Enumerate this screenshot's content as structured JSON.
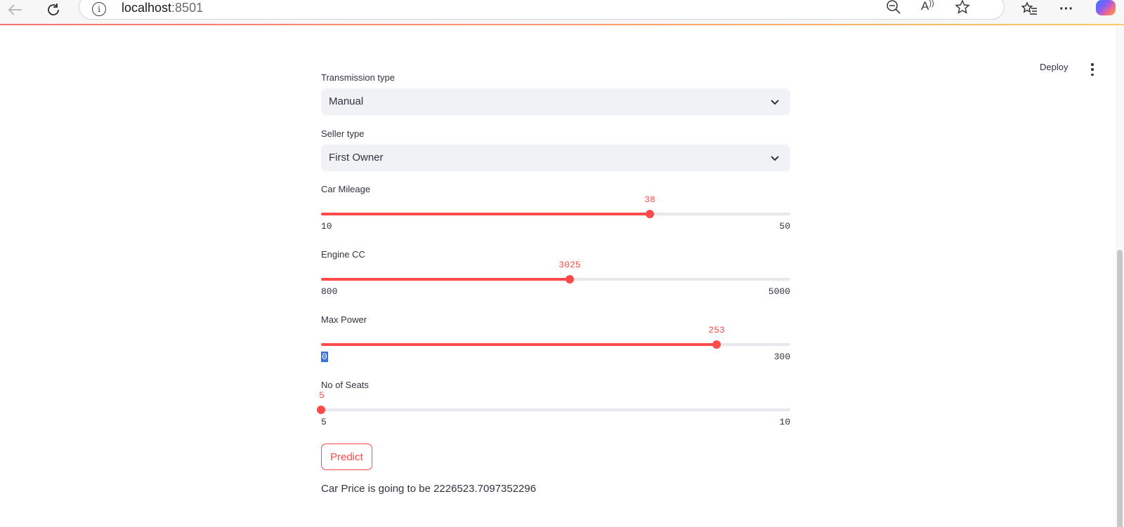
{
  "browser": {
    "url_host": "localhost",
    "url_port": ":8501"
  },
  "toolbar": {
    "deploy_label": "Deploy"
  },
  "form": {
    "transmission": {
      "label": "Transmission type",
      "value": "Manual"
    },
    "seller": {
      "label": "Seller type",
      "value": "First Owner"
    },
    "sliders": [
      {
        "label": "Car Mileage",
        "min": 10,
        "max": 50,
        "value": 38,
        "min_text": "10",
        "max_text": "50",
        "value_text": "38"
      },
      {
        "label": "Engine CC",
        "min": 800,
        "max": 5000,
        "value": 3025,
        "min_text": "800",
        "max_text": "5000",
        "value_text": "3025"
      },
      {
        "label": "Max Power",
        "min": 0,
        "max": 300,
        "value": 253,
        "min_text": "0",
        "max_text": "300",
        "value_text": "253"
      },
      {
        "label": "No of Seats",
        "min": 5,
        "max": 10,
        "value": 5,
        "min_text": "5",
        "max_text": "10",
        "value_text": "5"
      }
    ],
    "predict_label": "Predict",
    "result_text": "Car Price is going to be 2226523.7097352296"
  },
  "colors": {
    "accent": "#ff4b4b",
    "select_bg": "#f0f2f6",
    "text": "#31333f"
  }
}
